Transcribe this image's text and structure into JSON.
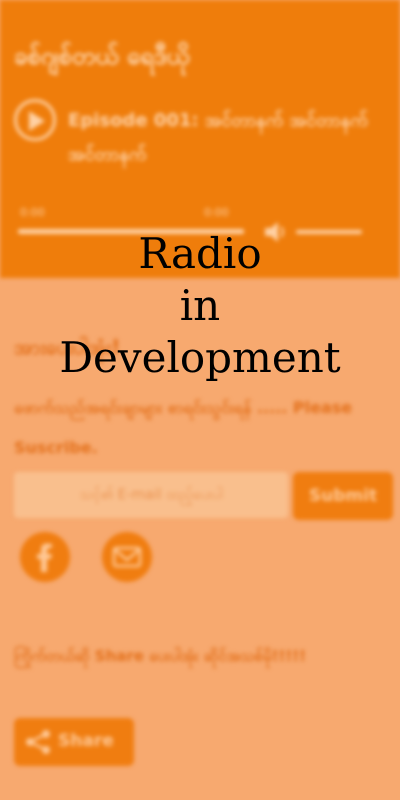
{
  "header": {
    "app_title": "ခစ်ဂျစ်တယ် ရေဒီယို",
    "episode_title": "Episode 001: အင်တာနက် အင်တာနက်အင်တာနက်",
    "current_time": "0:00",
    "duration": "0:00",
    "playback_progress": 0,
    "volume_level": 0.85
  },
  "newsletter": {
    "title": "အားပေးပါအုံး!",
    "description": "ဖောက်သည်အရင်းချာများ စာရင်းသွင်းရန် ..... Please Suscribe.",
    "email_placeholder": "သင့်၏ E-mail ထည့်ပေးပါ",
    "submit_label": "Submit"
  },
  "social": [
    "facebook-icon",
    "mail-icon"
  ],
  "share": {
    "text": "ကြိုက်တယ်ဆို Share ပေးပါအုံး ဆိုင်အသစ်မို!!!!!",
    "button_label": "Share"
  },
  "overlay": {
    "line1": "Radio",
    "line2": "in",
    "line3": "Development"
  },
  "colors": {
    "header_bg": "#ef7d0b",
    "page_bg": "#f7a96f",
    "accent": "#f07d10"
  }
}
